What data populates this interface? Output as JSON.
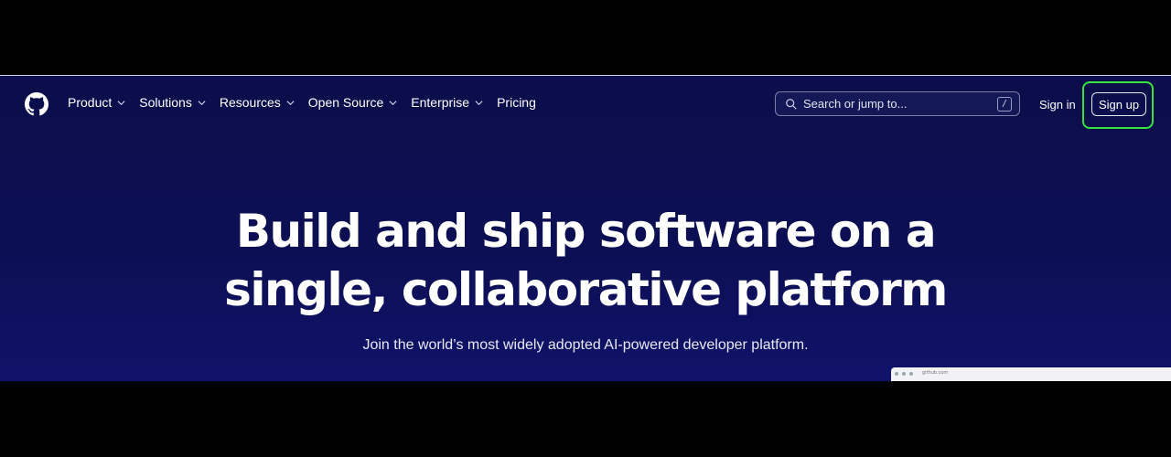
{
  "header": {
    "logo_icon": "github-mark-icon",
    "nav": [
      {
        "label": "Product",
        "has_dropdown": true
      },
      {
        "label": "Solutions",
        "has_dropdown": true
      },
      {
        "label": "Resources",
        "has_dropdown": true
      },
      {
        "label": "Open Source",
        "has_dropdown": true
      },
      {
        "label": "Enterprise",
        "has_dropdown": true
      },
      {
        "label": "Pricing",
        "has_dropdown": false
      }
    ],
    "search": {
      "placeholder": "Search or jump to...",
      "shortcut": "/"
    },
    "signin_label": "Sign in",
    "signup_label": "Sign up"
  },
  "hero": {
    "title_line1": "Build and ship software on a",
    "title_line2": "single, collaborative platform",
    "subtitle": "Join the world’s most widely adopted AI-powered developer platform."
  },
  "preview": {
    "url": "github.com"
  },
  "colors": {
    "background": "#0d0f55",
    "highlight": "#39e23b",
    "text": "#ffffff"
  }
}
